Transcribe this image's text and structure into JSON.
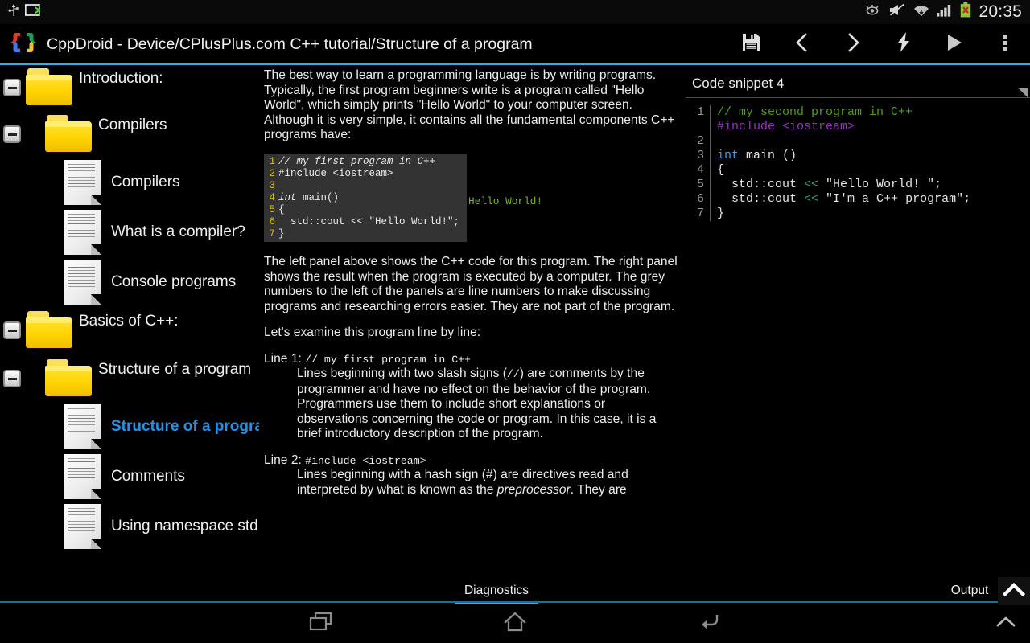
{
  "statusbar": {
    "icons": [
      "usb-icon",
      "screen-cast-icon",
      "eye-icon",
      "mute-icon",
      "wifi-icon",
      "signal-icon",
      "battery-icon"
    ],
    "clock": "20:35"
  },
  "actionbar": {
    "logo": "cppdroid-braces-logo",
    "title": "CppDroid - Device/CPlusPlus.com C++ tutorial/Structure of a program",
    "accent_color": "#3aa9e0",
    "actions": [
      {
        "name": "save-button",
        "icon": "floppy-disk-icon",
        "label": "Save"
      },
      {
        "name": "back-button",
        "icon": "chevron-left-icon",
        "label": "Back"
      },
      {
        "name": "forward-button",
        "icon": "chevron-right-icon",
        "label": "Forward"
      },
      {
        "name": "build-button",
        "icon": "lightning-bolt-icon",
        "label": "Build"
      },
      {
        "name": "run-button",
        "icon": "play-icon",
        "label": "Run"
      },
      {
        "name": "overflow-button",
        "icon": "more-vertical-icon",
        "label": "More options"
      }
    ]
  },
  "sidebar": {
    "items": [
      {
        "type": "folder",
        "label": "Introduction:",
        "indent": 0,
        "expander": "collapse",
        "selected": false
      },
      {
        "type": "folder",
        "label": "Compilers",
        "indent": 1,
        "expander": "collapse",
        "selected": false
      },
      {
        "type": "doc",
        "label": "Compilers",
        "indent": 2,
        "expander": "none",
        "selected": false
      },
      {
        "type": "doc",
        "label": "What is a compiler?",
        "indent": 2,
        "expander": "none",
        "selected": false
      },
      {
        "type": "doc",
        "label": "Console programs",
        "indent": 2,
        "expander": "none",
        "selected": false
      },
      {
        "type": "folder",
        "label": "Basics of C++:",
        "indent": 0,
        "expander": "collapse",
        "selected": false
      },
      {
        "type": "folder",
        "label": "Structure of a program",
        "indent": 1,
        "expander": "collapse",
        "selected": false
      },
      {
        "type": "doc",
        "label": "Structure of a program",
        "indent": 2,
        "expander": "none",
        "selected": true
      },
      {
        "type": "doc",
        "label": "Comments",
        "indent": 2,
        "expander": "none",
        "selected": false
      },
      {
        "type": "doc",
        "label": "Using namespace std",
        "indent": 2,
        "expander": "none",
        "selected": false
      }
    ],
    "selected_color": "#2b8fe0"
  },
  "content": {
    "intro_paragraph": "The best way to learn a programming language is by writing programs. Typically, the first program beginners write is a program called \"Hello World\", which simply prints \"Hello World\" to your computer screen. Although it is very simple, it contains all the fundamental components C++ programs have:",
    "example": {
      "lines": [
        {
          "n": "1",
          "text": "// my first program in C++",
          "italic": true
        },
        {
          "n": "2",
          "text": "#include <iostream>",
          "italic": false
        },
        {
          "n": "3",
          "text": "",
          "italic": false
        },
        {
          "n": "4",
          "text": "int main()",
          "italic": false
        },
        {
          "n": "5",
          "text": "{",
          "italic": false
        },
        {
          "n": "6",
          "text": "  std::cout << \"Hello World!\";",
          "italic": false
        },
        {
          "n": "7",
          "text": "}",
          "italic": false
        }
      ],
      "output": "Hello World!",
      "output_color": "#76b82a",
      "line_number_color": "#d8c200",
      "panel_bg": "#333333"
    },
    "explain_paragraph": "The left panel above shows the C++ code for this program. The right panel shows the result when the program is executed by a computer. The grey numbers to the left of the panels are line numbers to make discussing programs and researching errors easier. They are not part of the program.",
    "examine_paragraph": "Let's examine this program line by line:",
    "line1": {
      "label": "Line 1:",
      "code": "// my first program in C++",
      "body_a": "Lines beginning with two slash signs (",
      "body_code": "//",
      "body_b": ") are comments by the programmer and have no effect on the behavior of the program. Programmers use them to include short explanations or observations concerning the code or program. In this case, it is a brief introductory description of the program."
    },
    "line2": {
      "label": "Line 2:",
      "code": "#include <iostream>",
      "body_a": "Lines beginning with a hash sign (#) are directives read and interpreted by what is known as the ",
      "body_em": "preprocessor",
      "body_b": ". They are"
    }
  },
  "snippet": {
    "title": "Code snippet 4",
    "lines": [
      {
        "n": "1",
        "tokens": [
          {
            "t": "// my second program in C++",
            "c": "com"
          }
        ]
      },
      {
        "n": "",
        "tokens": [
          {
            "t": "#include <iostream>",
            "c": "pre"
          }
        ]
      },
      {
        "n": "2",
        "tokens": [
          {
            "t": "",
            "c": ""
          }
        ]
      },
      {
        "n": "3",
        "tokens": [
          {
            "t": "int",
            "c": "kw"
          },
          {
            "t": " main ()",
            "c": ""
          }
        ]
      },
      {
        "n": "4",
        "tokens": [
          {
            "t": "{",
            "c": ""
          }
        ]
      },
      {
        "n": "5",
        "tokens": [
          {
            "t": "  std::cout ",
            "c": ""
          },
          {
            "t": "<<",
            "c": "op"
          },
          {
            "t": " \"Hello World! \";",
            "c": ""
          }
        ]
      },
      {
        "n": "6",
        "tokens": [
          {
            "t": "  std::cout ",
            "c": ""
          },
          {
            "t": "<<",
            "c": "op"
          },
          {
            "t": " \"I'm a C++ program\";",
            "c": ""
          }
        ]
      },
      {
        "n": "7",
        "tokens": [
          {
            "t": "}",
            "c": ""
          }
        ]
      }
    ],
    "grip": "resize-grip-icon"
  },
  "tabbar": {
    "diagnostics_label": "Diagnostics",
    "output_label": "Output",
    "active_tab": "Diagnostics",
    "expand_icon": "chevron-up-icon"
  },
  "navbar": {
    "recents_label": "Recents",
    "home_label": "Home",
    "back_label": "Back",
    "expand_label": "Expand"
  }
}
